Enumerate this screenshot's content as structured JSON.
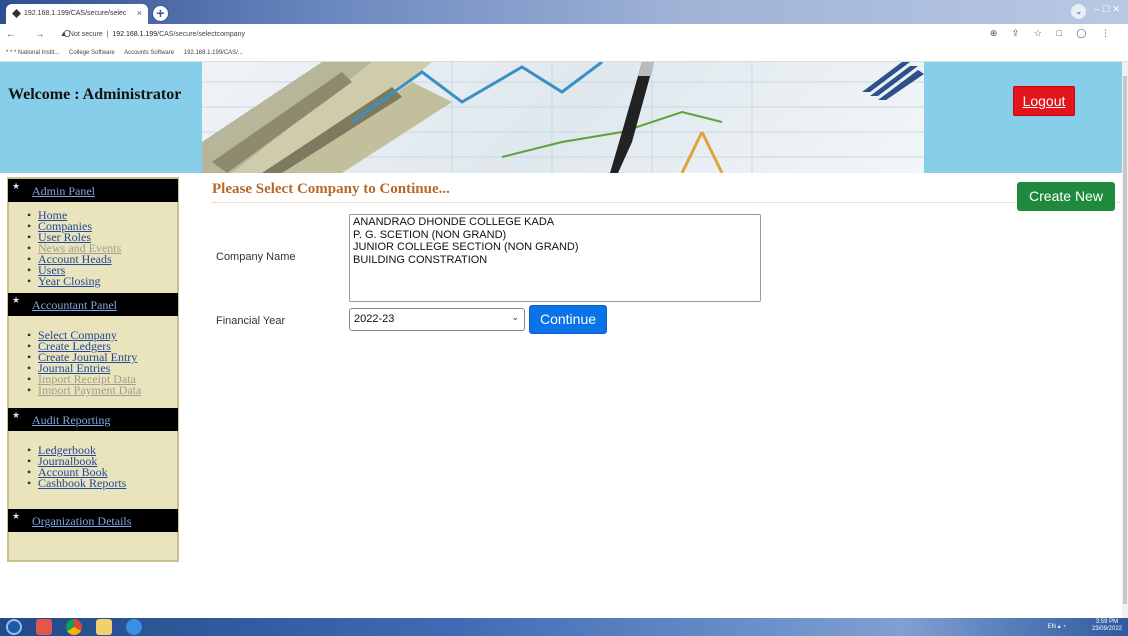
{
  "browser": {
    "tab_title": "192.168.1.199/CAS/secure/selec",
    "tab_close": "×",
    "new_tab": "+",
    "nav_glyphs": "← → C",
    "security": "Not secure",
    "url_host": "192.168.1.199",
    "url_path": "/CAS/secure/selectcompany",
    "toolbar_glyphs": "⊕ ⇪ ☆ □ ◯ ⋮",
    "window_controls": "– ☐ ✕",
    "bookmarks": [
      "* * * National Instit...",
      "College Software",
      "Accounts Software",
      "192.168.1.199/CAS/..."
    ]
  },
  "header": {
    "welcome": "Welcome : Administrator",
    "logout": "Logout"
  },
  "sidebar": {
    "sections": [
      {
        "title": "Admin Panel",
        "items": [
          {
            "label": "Home",
            "enabled": true
          },
          {
            "label": "Companies",
            "enabled": true
          },
          {
            "label": "User Roles",
            "enabled": true
          },
          {
            "label": "News and Events",
            "enabled": false
          },
          {
            "label": "Account Heads",
            "enabled": true
          },
          {
            "label": "Users",
            "enabled": true
          },
          {
            "label": "Year Closing",
            "enabled": true
          }
        ]
      },
      {
        "title": "Accountant Panel",
        "items": [
          {
            "label": "Select Company",
            "enabled": true
          },
          {
            "label": "Create Ledgers",
            "enabled": true
          },
          {
            "label": "Create Journal Entry",
            "enabled": true
          },
          {
            "label": "Journal Entries",
            "enabled": true
          },
          {
            "label": "Import Receipt Data",
            "enabled": false
          },
          {
            "label": "Import Payment Data",
            "enabled": false
          }
        ]
      },
      {
        "title": "Audit Reporting",
        "items": [
          {
            "label": "Ledgerbook",
            "enabled": true
          },
          {
            "label": "Journalbook",
            "enabled": true
          },
          {
            "label": "Account Book",
            "enabled": true
          },
          {
            "label": "Cashbook Reports",
            "enabled": true
          }
        ]
      },
      {
        "title": "Organization Details",
        "items": []
      }
    ]
  },
  "main": {
    "title": "Please Select Company to Continue...",
    "create_new": "Create New",
    "company_label": "Company Name",
    "companies": [
      "ANANDRAO DHONDE COLLEGE KADA",
      "P. G. SCETION (NON GRAND)",
      "JUNIOR COLLEGE SECTION (NON GRAND)",
      "BUILDING CONSTRATION"
    ],
    "year_label": "Financial Year",
    "year_value": "2022-23",
    "continue": "Continue"
  },
  "taskbar": {
    "lang": "EN",
    "time": "3:59 PM",
    "date": "23/09/2022"
  },
  "colors": {
    "header_bg": "#87ceeb",
    "logout_bg": "#e3141b",
    "create_new_bg": "#1f8a3e",
    "continue_bg": "#0a73e8",
    "title_color": "#b7692a",
    "sidebar_bg": "#e9e4bc"
  }
}
